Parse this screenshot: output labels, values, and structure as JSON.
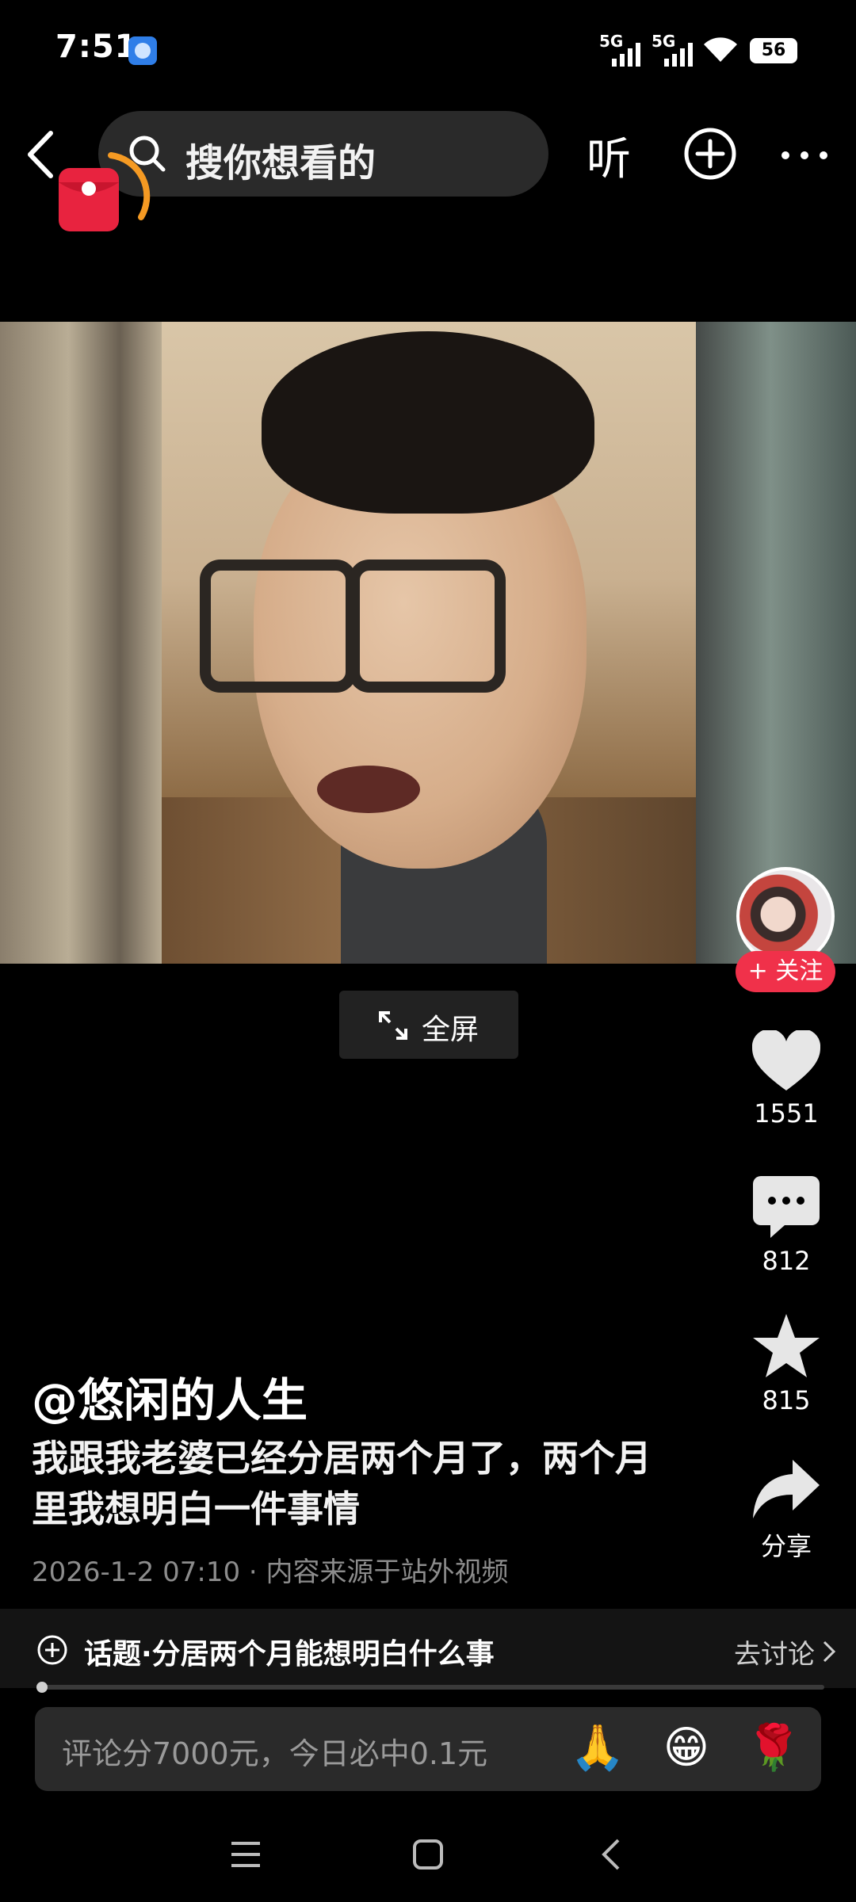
{
  "status_bar": {
    "time": "7:51",
    "sim1": "5G",
    "sim2": "5G",
    "battery": "56"
  },
  "top_bar": {
    "search_placeholder": "搜你想看的",
    "listen_label": "听"
  },
  "video": {
    "fullscreen_label": "全屏"
  },
  "creator": {
    "follow_label": "+ 关注"
  },
  "actions": {
    "likes": "1551",
    "comments": "812",
    "favorites": "815",
    "share_label": "分享"
  },
  "post": {
    "author": "@悠闲的人生",
    "description": "我跟我老婆已经分居两个月了，两个月里我想明白一件事情",
    "meta": "2026-1-2 07:10 · 内容来源于站外视频"
  },
  "topic": {
    "label": "话题·分居两个月能想明白什么事",
    "action": "去讨论"
  },
  "comment": {
    "placeholder": "评论分7000元，今日必中0.1元",
    "emojis": [
      "🙏",
      "😁",
      "🌹"
    ]
  }
}
